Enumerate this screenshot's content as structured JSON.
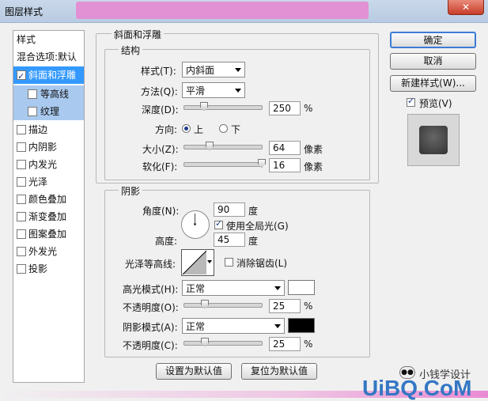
{
  "window": {
    "title": "图层样式",
    "close": "✕"
  },
  "left_panel": {
    "header": "样式",
    "blend": "混合选项:默认",
    "items": [
      {
        "label": "斜面和浮雕",
        "checked": true
      },
      {
        "label": "等高线",
        "checked": false
      },
      {
        "label": "纹理",
        "checked": false
      },
      {
        "label": "描边",
        "checked": false
      },
      {
        "label": "内阴影",
        "checked": false
      },
      {
        "label": "内发光",
        "checked": false
      },
      {
        "label": "光泽",
        "checked": false
      },
      {
        "label": "颜色叠加",
        "checked": false
      },
      {
        "label": "渐变叠加",
        "checked": false
      },
      {
        "label": "图案叠加",
        "checked": false
      },
      {
        "label": "外发光",
        "checked": false
      },
      {
        "label": "投影",
        "checked": false
      }
    ]
  },
  "bevel": {
    "group_title": "斜面和浮雕",
    "structure_title": "结构",
    "style_label": "样式(T):",
    "style_value": "内斜面",
    "technique_label": "方法(Q):",
    "technique_value": "平滑",
    "depth_label": "深度(D):",
    "depth_value": "250",
    "depth_unit": "%",
    "direction_label": "方向:",
    "dir_up": "上",
    "dir_down": "下",
    "size_label": "大小(Z):",
    "size_value": "64",
    "size_unit": "像素",
    "soften_label": "软化(F):",
    "soften_value": "16",
    "soften_unit": "像素"
  },
  "shading": {
    "title": "阴影",
    "angle_label": "角度(N):",
    "angle_value": "90",
    "angle_unit": "度",
    "global_light": "使用全局光(G)",
    "altitude_label": "高度:",
    "altitude_value": "45",
    "altitude_unit": "度",
    "gloss_label": "光泽等高线:",
    "antialias": "消除锯齿(L)",
    "highlight_label": "高光模式(H):",
    "highlight_value": "正常",
    "hl_opacity_label": "不透明度(O):",
    "hl_opacity_value": "25",
    "hl_opacity_unit": "%",
    "shadow_label": "阴影模式(A):",
    "shadow_value": "正常",
    "sh_opacity_label": "不透明度(C):",
    "sh_opacity_value": "25",
    "sh_opacity_unit": "%",
    "highlight_color": "#ffffff",
    "shadow_color": "#000000"
  },
  "footer": {
    "make_default": "设置为默认值",
    "reset_default": "复位为默认值"
  },
  "right": {
    "ok": "确定",
    "cancel": "取消",
    "new_style": "新建样式(W)...",
    "preview": "预览(V)"
  },
  "watermark": {
    "wechat": "小钱学设计",
    "site": "UiBQ.CoM"
  }
}
